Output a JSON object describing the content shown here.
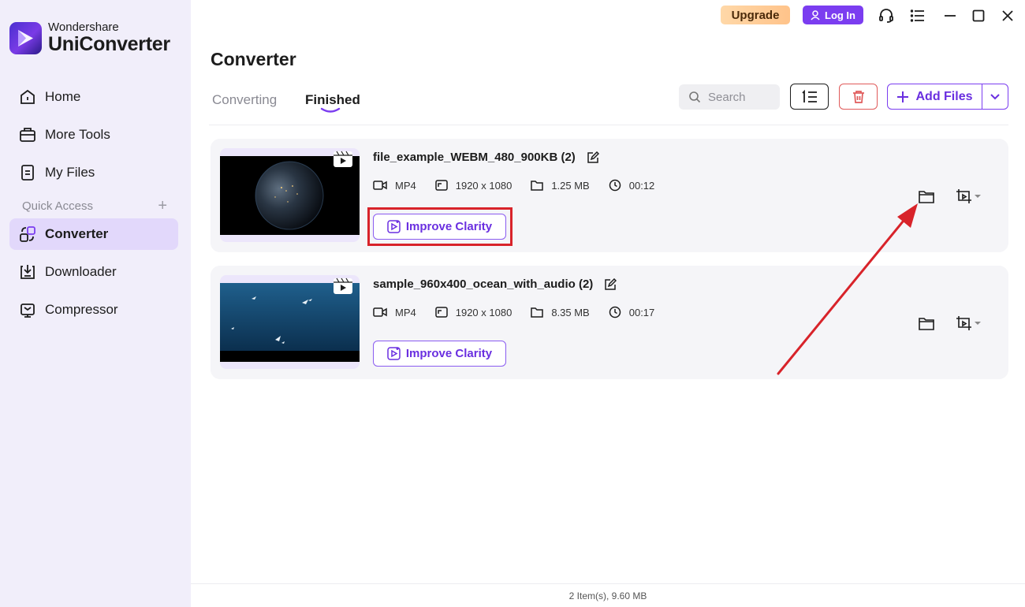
{
  "brand": {
    "small": "Wondershare",
    "name": "UniConverter"
  },
  "sidebar": {
    "items": [
      {
        "label": "Home",
        "icon": "home-icon"
      },
      {
        "label": "More Tools",
        "icon": "toolbox-icon"
      },
      {
        "label": "My Files",
        "icon": "file-icon"
      }
    ],
    "quick_access_label": "Quick Access",
    "quick_items": [
      {
        "label": "Converter",
        "icon": "converter-icon",
        "active": true
      },
      {
        "label": "Downloader",
        "icon": "download-icon"
      },
      {
        "label": "Compressor",
        "icon": "compress-icon"
      }
    ]
  },
  "topbar": {
    "upgrade_label": "Upgrade",
    "login_label": "Log In"
  },
  "header": {
    "title": "Converter",
    "tabs": [
      {
        "label": "Converting",
        "active": false
      },
      {
        "label": "Finished",
        "active": true
      }
    ],
    "search_placeholder": "Search",
    "add_files_label": "Add Files"
  },
  "files": [
    {
      "name": "file_example_WEBM_480_900KB (2)",
      "format": "MP4",
      "resolution": "1920 x 1080",
      "size": "1.25 MB",
      "duration": "00:12",
      "improve_label": "Improve Clarity"
    },
    {
      "name": "sample_960x400_ocean_with_audio (2)",
      "format": "MP4",
      "resolution": "1920 x 1080",
      "size": "8.35 MB",
      "duration": "00:17",
      "improve_label": "Improve Clarity"
    }
  ],
  "status_bar": {
    "summary": "2 Item(s), 9.60 MB"
  },
  "colors": {
    "accent": "#7b3df0",
    "highlight": "#d8232a",
    "sidebar_bg": "#f1eefa"
  }
}
